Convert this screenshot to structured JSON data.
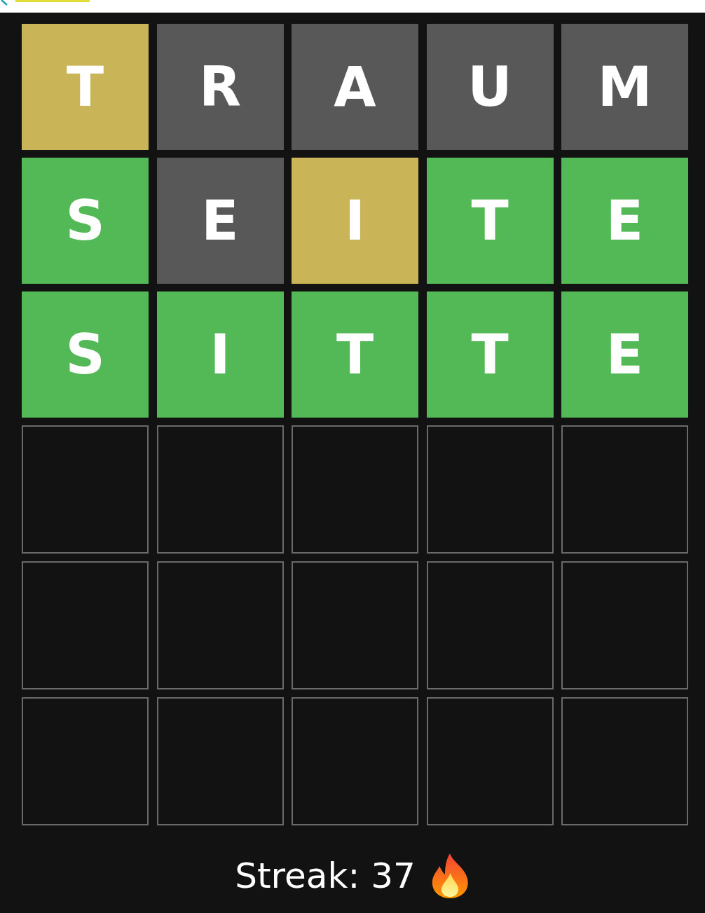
{
  "rows": [
    {
      "tiles": [
        {
          "letter": "T",
          "kind": "present"
        },
        {
          "letter": "R",
          "kind": "absent"
        },
        {
          "letter": "A",
          "kind": "absent"
        },
        {
          "letter": "U",
          "kind": "absent"
        },
        {
          "letter": "M",
          "kind": "absent"
        }
      ]
    },
    {
      "tiles": [
        {
          "letter": "S",
          "kind": "correct"
        },
        {
          "letter": "E",
          "kind": "absent"
        },
        {
          "letter": "I",
          "kind": "present"
        },
        {
          "letter": "T",
          "kind": "correct"
        },
        {
          "letter": "E",
          "kind": "correct"
        }
      ]
    },
    {
      "tiles": [
        {
          "letter": "S",
          "kind": "correct"
        },
        {
          "letter": "I",
          "kind": "correct"
        },
        {
          "letter": "T",
          "kind": "correct"
        },
        {
          "letter": "T",
          "kind": "correct"
        },
        {
          "letter": "E",
          "kind": "correct"
        }
      ]
    },
    {
      "tiles": [
        {
          "kind": "empty"
        },
        {
          "kind": "empty"
        },
        {
          "kind": "empty"
        },
        {
          "kind": "empty"
        },
        {
          "kind": "empty"
        }
      ]
    },
    {
      "tiles": [
        {
          "kind": "empty"
        },
        {
          "kind": "empty"
        },
        {
          "kind": "empty"
        },
        {
          "kind": "empty"
        },
        {
          "kind": "empty"
        }
      ]
    },
    {
      "tiles": [
        {
          "kind": "empty"
        },
        {
          "kind": "empty"
        },
        {
          "kind": "empty"
        },
        {
          "kind": "empty"
        },
        {
          "kind": "empty"
        }
      ]
    }
  ],
  "streak": "Streak: 37"
}
